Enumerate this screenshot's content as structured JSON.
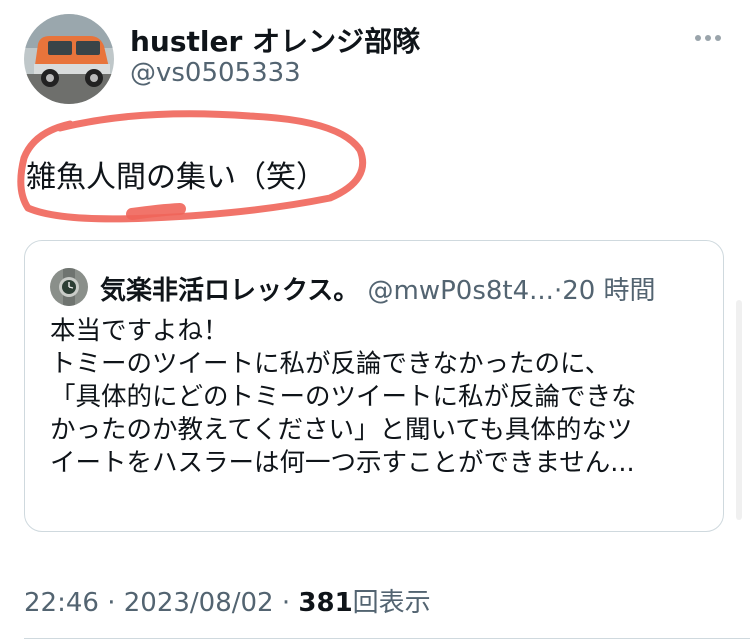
{
  "tweet": {
    "author": {
      "display_name": "hustler オレンジ部隊",
      "handle": "@vs0505333",
      "avatar_icon": "orange-car-photo"
    },
    "more_icon": "more-horizontal-icon",
    "text": "雑魚人間の集い（笑）",
    "highlight_color": "#f0655a",
    "quote": {
      "author_name": "気楽非活ロレックス。",
      "author_handle": "@mwP0s8t4...",
      "separator": "·",
      "time": "20 時間",
      "avatar_icon": "wristwatch-photo",
      "lines": [
        "本当ですよね！",
        "トミーのツイートに私が反論できなかったのに、",
        "「具体的にどのトミーのツイートに私が反論できな",
        "かったのか教えてください」と聞いても具体的なツ",
        "イートをハスラーは何一つ示すことができません..."
      ]
    },
    "meta": {
      "time": "22:46",
      "separator1": "·",
      "date": "2023/08/02",
      "separator2": "·",
      "view_count": "381",
      "view_label": "回表示"
    }
  },
  "colors": {
    "text_primary": "#0f1419",
    "text_secondary": "#536471",
    "border": "#cfd9de",
    "car_orange": "#e8743b"
  }
}
